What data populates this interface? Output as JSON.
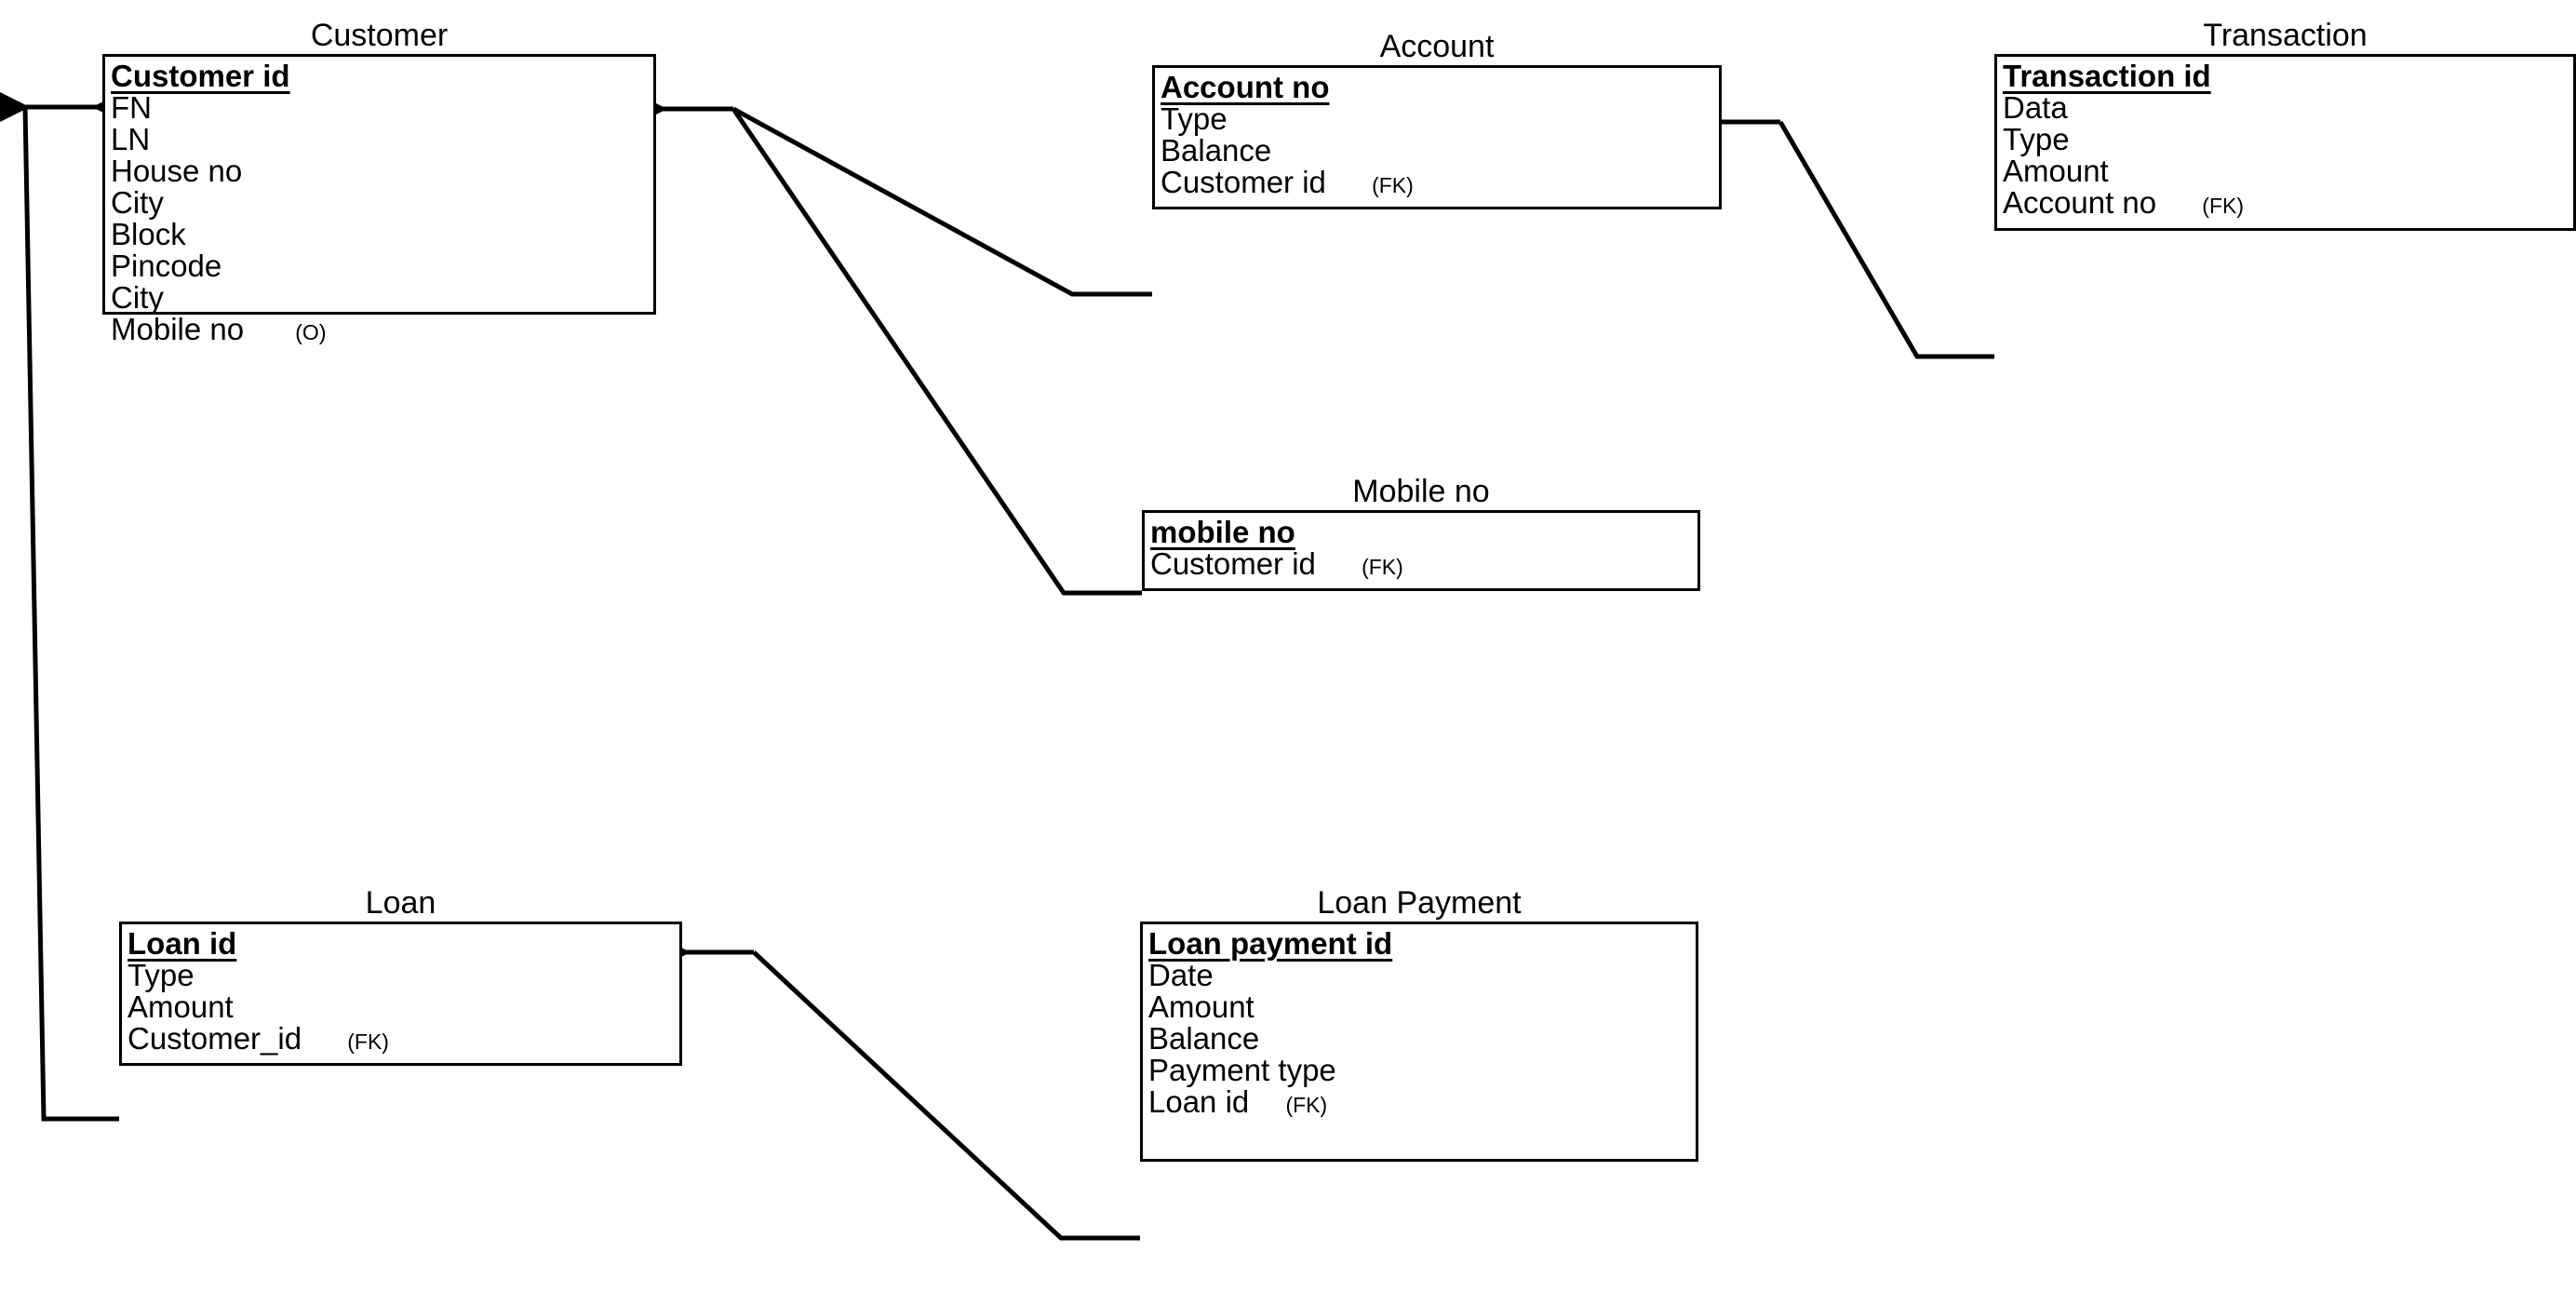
{
  "diagram": {
    "type": "entity-relationship-diagram",
    "notation": "crows-foot-arrow",
    "background_color": "#ffffff",
    "line_color": "#000000",
    "text_color": "#000000",
    "legend": {
      "pk_marker": "bold underlined",
      "fk_marker": "(FK)",
      "optional_marker": "(O)"
    }
  },
  "entities": [
    {
      "id": "customer",
      "title": "Customer",
      "attributes": [
        {
          "name": "Customer id",
          "key": "PK",
          "tag": ""
        },
        {
          "name": "FN",
          "key": "",
          "tag": ""
        },
        {
          "name": "LN",
          "key": "",
          "tag": ""
        },
        {
          "name": "House no",
          "key": "",
          "tag": ""
        },
        {
          "name": "City",
          "key": "",
          "tag": ""
        },
        {
          "name": "Block",
          "key": "",
          "tag": ""
        },
        {
          "name": "Pincode",
          "key": "",
          "tag": ""
        },
        {
          "name": "City",
          "key": "",
          "tag": ""
        },
        {
          "name": "Mobile no",
          "key": "",
          "tag": "(O)"
        }
      ]
    },
    {
      "id": "account",
      "title": "Account",
      "attributes": [
        {
          "name": "Account no",
          "key": "PK",
          "tag": ""
        },
        {
          "name": "Type",
          "key": "",
          "tag": ""
        },
        {
          "name": "Balance",
          "key": "",
          "tag": ""
        },
        {
          "name": "Customer id",
          "key": "FK",
          "tag": "(FK)"
        }
      ]
    },
    {
      "id": "transaction",
      "title": "Transaction",
      "attributes": [
        {
          "name": "Transaction id",
          "key": "PK",
          "tag": ""
        },
        {
          "name": "Data",
          "key": "",
          "tag": ""
        },
        {
          "name": "Type",
          "key": "",
          "tag": ""
        },
        {
          "name": "Amount",
          "key": "",
          "tag": ""
        },
        {
          "name": "Account no",
          "key": "FK",
          "tag": "(FK)"
        }
      ]
    },
    {
      "id": "mobileno",
      "title": "Mobile no",
      "attributes": [
        {
          "name": "mobile no",
          "key": "PK",
          "tag": ""
        },
        {
          "name": "Customer id",
          "key": "FK",
          "tag": "(FK)"
        }
      ]
    },
    {
      "id": "loan",
      "title": "Loan",
      "attributes": [
        {
          "name": "Loan id",
          "key": "PK",
          "tag": ""
        },
        {
          "name": "Type",
          "key": "",
          "tag": ""
        },
        {
          "name": "Amount",
          "key": "",
          "tag": ""
        },
        {
          "name": "Customer_id",
          "key": "FK",
          "tag": "(FK)"
        }
      ]
    },
    {
      "id": "loanpayment",
      "title": "Loan Payment",
      "attributes": [
        {
          "name": "Loan payment id",
          "key": "PK",
          "tag": ""
        },
        {
          "name": "Date",
          "key": "",
          "tag": ""
        },
        {
          "name": "Amount",
          "key": "",
          "tag": ""
        },
        {
          "name": "Balance",
          "key": "",
          "tag": ""
        },
        {
          "name": "Payment type",
          "key": "",
          "tag": ""
        },
        {
          "name": "Loan id",
          "key": "FK",
          "tag": "(FK)"
        }
      ]
    }
  ],
  "relationships": [
    {
      "id": "rel-account-customer",
      "from": "account",
      "from_attribute": "Customer id",
      "to": "customer",
      "to_attribute": "Customer id"
    },
    {
      "id": "rel-mobileno-customer",
      "from": "mobileno",
      "from_attribute": "Customer id",
      "to": "customer",
      "to_attribute": "Customer id"
    },
    {
      "id": "rel-transaction-account",
      "from": "transaction",
      "from_attribute": "Account no",
      "to": "account",
      "to_attribute": "Account no"
    },
    {
      "id": "rel-loan-customer",
      "from": "loan",
      "from_attribute": "Customer_id",
      "to": "customer",
      "to_attribute": "Customer id"
    },
    {
      "id": "rel-loanpayment-loan",
      "from": "loanpayment",
      "from_attribute": "Loan id",
      "to": "loan",
      "to_attribute": "Loan id"
    }
  ]
}
